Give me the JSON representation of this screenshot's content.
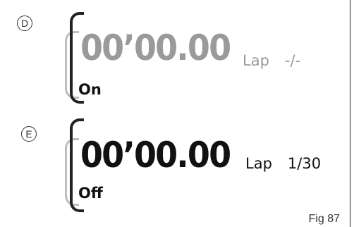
{
  "panels": [
    {
      "marker": "D",
      "time": "00’00.00",
      "lap_label": "Lap",
      "lap_value": "-/-",
      "state": "On",
      "time_color": "#9a9a9a",
      "lap_color": "#9a9a9a",
      "bracket_style": "grey-inner"
    },
    {
      "marker": "E",
      "time": "00’00.00",
      "lap_label": "Lap",
      "lap_value": "1/30",
      "state": "Off",
      "time_color": "#111111",
      "lap_color": "#111111",
      "bracket_style": "gray-outer"
    }
  ],
  "figure_label": "Fig 87"
}
